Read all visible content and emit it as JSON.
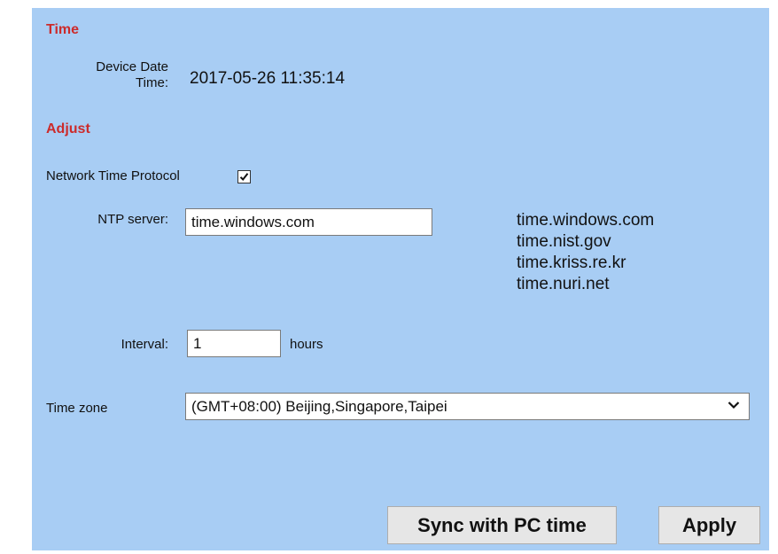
{
  "time_section": {
    "title": "Time",
    "device_date_time_label_line1": "Device Date",
    "device_date_time_label_line2": "Time:",
    "device_date_time_value": "2017-05-26 11:35:14"
  },
  "adjust_section": {
    "title": "Adjust",
    "ntp_label": "Network Time Protocol",
    "ntp_checked": true,
    "ntp_server_label": "NTP server:",
    "ntp_server_value": "time.windows.com",
    "ntp_server_suggestions": [
      "time.windows.com",
      "time.nist.gov",
      "time.kriss.re.kr",
      "time.nuri.net"
    ],
    "interval_label": "Interval:",
    "interval_value": "1",
    "interval_unit": "hours",
    "time_zone_label": "Time zone",
    "time_zone_value": "(GMT+08:00) Beijing,Singapore,Taipei"
  },
  "buttons": {
    "sync_label": "Sync with PC time",
    "apply_label": "Apply"
  },
  "colors": {
    "panel_background": "#a8cdf4",
    "section_title": "#cc2b2b"
  },
  "icons": {
    "checkbox": "check-icon",
    "dropdown": "chevron-down-icon"
  }
}
